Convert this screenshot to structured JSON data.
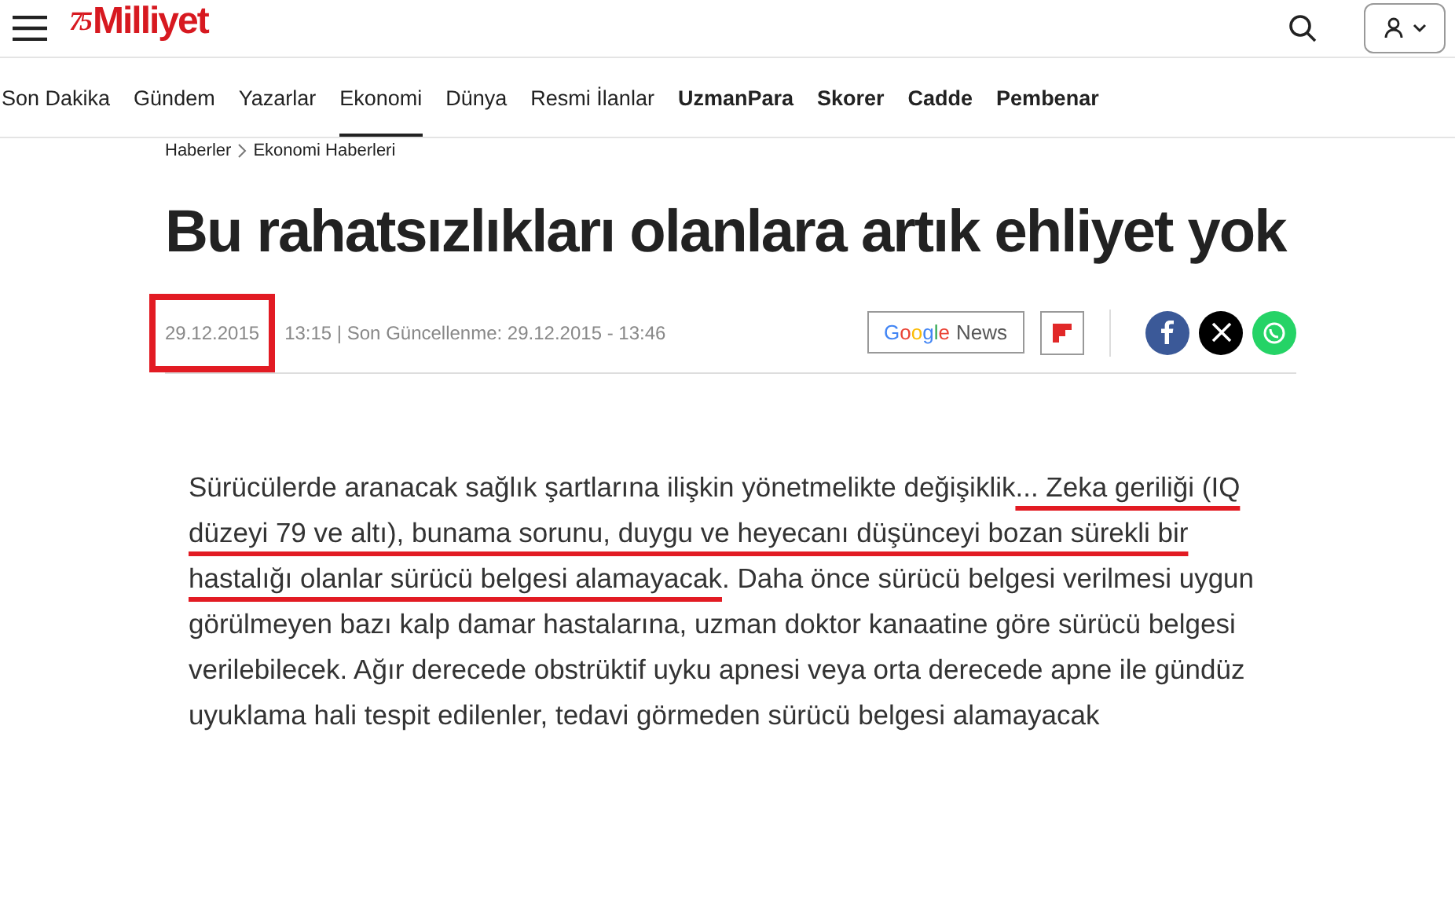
{
  "header": {
    "logo": {
      "emblem": "75",
      "name": "Milliyet"
    }
  },
  "nav": [
    {
      "label": "Son Dakika",
      "kind": "section",
      "selected": false
    },
    {
      "label": "Gündem",
      "kind": "section",
      "selected": false
    },
    {
      "label": "Yazarlar",
      "kind": "section",
      "selected": false
    },
    {
      "label": "Ekonomi",
      "kind": "section",
      "selected": true
    },
    {
      "label": "Dünya",
      "kind": "section",
      "selected": false
    },
    {
      "label": "Resmi İlanlar",
      "kind": "section",
      "selected": false
    },
    {
      "label": "UzmanPara",
      "kind": "brand",
      "selected": false
    },
    {
      "label": "Skorer",
      "kind": "brand",
      "selected": false
    },
    {
      "label": "Cadde",
      "kind": "brand",
      "selected": false
    },
    {
      "label": "Pembenar",
      "kind": "brand",
      "selected": false
    }
  ],
  "breadcrumb": [
    "Haberler",
    "Ekonomi Haberleri"
  ],
  "article": {
    "headline": "Bu rahatsızlıkları olanlara artık ehliyet yok",
    "meta": {
      "date": "29.12.2015",
      "date_marked": true,
      "rest": "13:15 | Son Güncellenme: 29.12.2015 - 13:46"
    },
    "google_news": {
      "brand": "Google",
      "label": "News"
    },
    "paragraph": {
      "before": "Sürücülerde aranacak sağlık şartlarına ilişkin yönetmelikte değişiklik",
      "highlight": "... Zeka geriliği (IQ düzeyi 79 ve altı), bunama sorunu, duygu ve heyecanı düşünceyi bozan sürekli bir hastalığı olanlar sürücü belgesi alamayacak",
      "after": ". Daha önce sürücü belgesi verilmesi uygun görülmeyen bazı kalp damar hastalarına, uzman doktor kanaatine göre sürücü belgesi verilebilecek. Ağır derecede obstrüktif uyku apnesi veya orta derecede apne ile gündüz uyuklama hali tespit edilenler, tedavi görmeden sürücü belgesi alamayacak"
    }
  }
}
